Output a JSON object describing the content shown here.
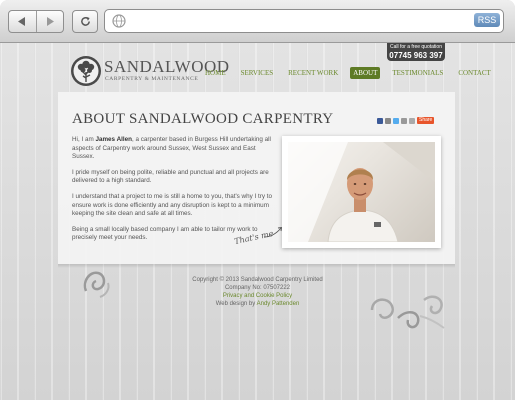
{
  "browser": {
    "back_icon": "back-arrow-icon",
    "forward_icon": "forward-arrow-icon",
    "reload_icon": "reload-icon",
    "rss_label": "RSS"
  },
  "header": {
    "call_label": "Call for a free quotation",
    "phone": "07745 963 397",
    "logo_title": "SANDALWOOD",
    "logo_subtitle": "CARPENTRY & MAINTENANCE",
    "nav": [
      {
        "label": "HOME",
        "active": false
      },
      {
        "label": "SERVICES",
        "active": false
      },
      {
        "label": "RECENT WORK",
        "active": false
      },
      {
        "label": "ABOUT",
        "active": true
      },
      {
        "label": "TESTIMONIALS",
        "active": false
      },
      {
        "label": "CONTACT",
        "active": false
      }
    ]
  },
  "main": {
    "title": "ABOUT SANDALWOOD CARPENTRY",
    "share_label": "Share",
    "para1_pre": "Hi, I am ",
    "para1_name": "James Allen",
    "para1_post": ", a carpenter based in Burgess Hill undertaking all aspects of Carpentry work around Sussex, West Sussex and East Sussex.",
    "para2": "I pride myself on being polite, reliable and punctual and all projects are delivered to a high standard.",
    "para3": "I understand that a project to me is still a home to you, that's why I try to ensure work is done efficiently and any disruption is kept to a minimum keeping the site clean and safe at all times.",
    "para4": "Being a small locally based company I am able to tailor my work to precisely meet your needs.",
    "photo_caption": "That's me"
  },
  "footer": {
    "copyright": "Copyright © 2013 Sandalwood Carpentry Limited",
    "company_no": "Company No: 07507222",
    "privacy": "Privacy and Cookie Policy",
    "design_pre": "Web design by ",
    "design_link": "Andy Pattenden"
  },
  "colors": {
    "accent": "#6c8a2e",
    "active_nav": "#5e7b25",
    "heading": "#444444"
  }
}
